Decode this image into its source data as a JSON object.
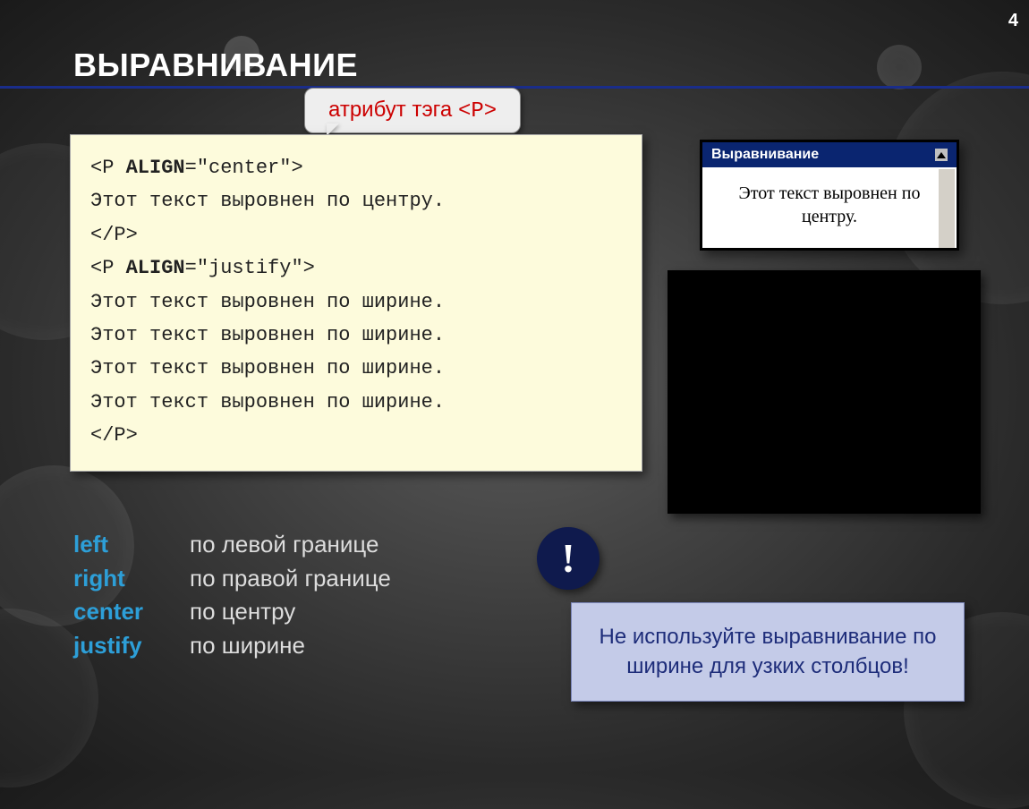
{
  "pageNumber": "4",
  "title": "ВЫРАВНИВАНИЕ",
  "callout": {
    "label": "атрибут тэга ",
    "tag": "<P>"
  },
  "code": {
    "line1a": "<P ",
    "line1b": "ALIGN",
    "line1c": "=\"center\">",
    "line2": "Этот текст выровнен по центру.",
    "line3": "</P>",
    "line4a": "<P ",
    "line4b": "ALIGN",
    "line4c": "=\"justify\">",
    "line5": "Этот текст выровнен по ширине.",
    "line6": "Этот текст выровнен по ширине.",
    "line7": "Этот текст выровнен по ширине.",
    "line8": "Этот текст выровнен по ширине.",
    "line9": "</P>"
  },
  "browser": {
    "title": "Выравнивание",
    "body": "Этот текст выровнен по центру."
  },
  "alignList": [
    {
      "key": "left",
      "desc": "по левой границе"
    },
    {
      "key": "right",
      "desc": "по правой границе"
    },
    {
      "key": "center",
      "desc": "по центру"
    },
    {
      "key": "justify",
      "desc": "по ширине"
    }
  ],
  "warning": {
    "mark": "!",
    "text": "Не используйте выравнивание по ширине для узких столбцов!"
  }
}
